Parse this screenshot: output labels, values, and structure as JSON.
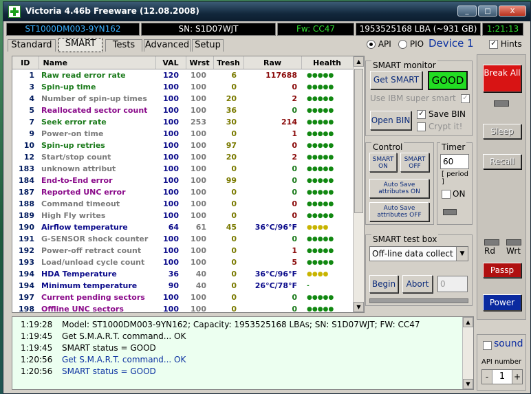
{
  "window": {
    "title": "Victoria 4.46b Freeware (12.08.2008)",
    "controls": [
      "_",
      "□",
      "X"
    ]
  },
  "info": {
    "model": "ST1000DM003-9YN162",
    "serial": "SN: S1D07WJT",
    "firmware": "Fw: CC47",
    "capacity": "1953525168 LBA (~931 GB)",
    "clock": "1:21:13"
  },
  "tabs": [
    {
      "label": "Standard"
    },
    {
      "label": "SMART"
    },
    {
      "label": "Tests"
    },
    {
      "label": "Advanced"
    },
    {
      "label": "Setup"
    }
  ],
  "mode": {
    "api_label": "API",
    "pio_label": "PIO",
    "device": "Device 1",
    "hints_label": "Hints"
  },
  "table": {
    "headers": [
      "ID",
      "Name",
      "VAL",
      "Wrst",
      "Tresh",
      "Raw",
      "Health"
    ],
    "rows": [
      {
        "id": "1",
        "name": "Raw read error rate",
        "val": "120",
        "wrst": "100",
        "tresh": "6",
        "raw": "117688",
        "health": "●●●●●",
        "nc": "#1a7a1a",
        "rc": "#8a0a0a",
        "hc": "#118811"
      },
      {
        "id": "3",
        "name": "Spin-up time",
        "val": "100",
        "wrst": "100",
        "tresh": "0",
        "raw": "0",
        "health": "●●●●●",
        "nc": "#1a7a1a",
        "rc": "#8a0a0a",
        "hc": "#118811"
      },
      {
        "id": "4",
        "name": "Number of spin-up times",
        "val": "100",
        "wrst": "100",
        "tresh": "20",
        "raw": "2",
        "health": "●●●●●",
        "nc": "#7a7a7a",
        "rc": "#8a0a0a",
        "hc": "#118811"
      },
      {
        "id": "5",
        "name": "Reallocated sector count",
        "val": "100",
        "wrst": "100",
        "tresh": "36",
        "raw": "0",
        "health": "●●●●●",
        "nc": "#8a0a8a",
        "rc": "#1a7a1a",
        "hc": "#118811"
      },
      {
        "id": "7",
        "name": "Seek error rate",
        "val": "100",
        "wrst": "253",
        "tresh": "30",
        "raw": "214",
        "health": "●●●●●",
        "nc": "#1a7a1a",
        "rc": "#8a0a0a",
        "hc": "#118811"
      },
      {
        "id": "9",
        "name": "Power-on time",
        "val": "100",
        "wrst": "100",
        "tresh": "0",
        "raw": "1",
        "health": "●●●●●",
        "nc": "#7a7a7a",
        "rc": "#8a0a0a",
        "hc": "#118811"
      },
      {
        "id": "10",
        "name": "Spin-up retries",
        "val": "100",
        "wrst": "100",
        "tresh": "97",
        "raw": "0",
        "health": "●●●●●",
        "nc": "#1a7a1a",
        "rc": "#8a0a0a",
        "hc": "#118811"
      },
      {
        "id": "12",
        "name": "Start/stop count",
        "val": "100",
        "wrst": "100",
        "tresh": "20",
        "raw": "2",
        "health": "●●●●●",
        "nc": "#7a7a7a",
        "rc": "#8a0a0a",
        "hc": "#118811"
      },
      {
        "id": "183",
        "name": "unknown attribut",
        "val": "100",
        "wrst": "100",
        "tresh": "0",
        "raw": "0",
        "health": "●●●●●",
        "nc": "#7a7a7a",
        "rc": "#1a7a1a",
        "hc": "#118811"
      },
      {
        "id": "184",
        "name": "End-to-End error",
        "val": "100",
        "wrst": "100",
        "tresh": "99",
        "raw": "0",
        "health": "●●●●●",
        "nc": "#8a0a8a",
        "rc": "#1a7a1a",
        "hc": "#118811"
      },
      {
        "id": "187",
        "name": "Reported UNC error",
        "val": "100",
        "wrst": "100",
        "tresh": "0",
        "raw": "0",
        "health": "●●●●●",
        "nc": "#8a0a8a",
        "rc": "#1a7a1a",
        "hc": "#118811"
      },
      {
        "id": "188",
        "name": "Command timeout",
        "val": "100",
        "wrst": "100",
        "tresh": "0",
        "raw": "0",
        "health": "●●●●●",
        "nc": "#7a7a7a",
        "rc": "#8a0a0a",
        "hc": "#118811"
      },
      {
        "id": "189",
        "name": "High Fly writes",
        "val": "100",
        "wrst": "100",
        "tresh": "0",
        "raw": "0",
        "health": "●●●●●",
        "nc": "#7a7a7a",
        "rc": "#8a0a0a",
        "hc": "#118811"
      },
      {
        "id": "190",
        "name": "Airflow temperature",
        "val": "64",
        "wrst": "61",
        "tresh": "45",
        "raw": "36°C/96°F",
        "health": "●●●●",
        "nc": "#0a0a8a",
        "rc": "#0a0a8a",
        "hc": "#c8b400"
      },
      {
        "id": "191",
        "name": "G-SENSOR shock counter",
        "val": "100",
        "wrst": "100",
        "tresh": "0",
        "raw": "0",
        "health": "●●●●●",
        "nc": "#7a7a7a",
        "rc": "#1a7a1a",
        "hc": "#118811"
      },
      {
        "id": "192",
        "name": "Power-off retract count",
        "val": "100",
        "wrst": "100",
        "tresh": "0",
        "raw": "1",
        "health": "●●●●●",
        "nc": "#7a7a7a",
        "rc": "#8a0a0a",
        "hc": "#118811"
      },
      {
        "id": "193",
        "name": "Load/unload cycle count",
        "val": "100",
        "wrst": "100",
        "tresh": "0",
        "raw": "5",
        "health": "●●●●●",
        "nc": "#7a7a7a",
        "rc": "#8a0a0a",
        "hc": "#118811"
      },
      {
        "id": "194",
        "name": "HDA Temperature",
        "val": "36",
        "wrst": "40",
        "tresh": "0",
        "raw": "36°C/96°F",
        "health": "●●●●",
        "nc": "#0a0a8a",
        "rc": "#0a0a8a",
        "hc": "#c8b400"
      },
      {
        "id": "194",
        "name": "Minimum temperature",
        "val": "90",
        "wrst": "40",
        "tresh": "0",
        "raw": "26°C/78°F",
        "health": "-",
        "nc": "#0a0a8a",
        "rc": "#0a0a8a",
        "hc": "#118811"
      },
      {
        "id": "197",
        "name": "Current pending sectors",
        "val": "100",
        "wrst": "100",
        "tresh": "0",
        "raw": "0",
        "health": "●●●●●",
        "nc": "#8a0a8a",
        "rc": "#1a7a1a",
        "hc": "#118811"
      },
      {
        "id": "198",
        "name": "Offline UNC sectors",
        "val": "100",
        "wrst": "100",
        "tresh": "0",
        "raw": "0",
        "health": "●●●●●",
        "nc": "#8a0a8a",
        "rc": "#1a7a1a",
        "hc": "#118811"
      }
    ]
  },
  "smart_monitor": {
    "title": "SMART monitor",
    "get_smart": "Get SMART",
    "status": "GOOD",
    "ibm_label": "Use IBM super smart",
    "open_bin": "Open BIN",
    "save_bin": "Save BIN",
    "crypt": "Crypt it!"
  },
  "control": {
    "title": "Control",
    "smart_on": "SMART ON",
    "smart_off": "SMART OFF",
    "autosave_on": "Auto Save attributes ON",
    "autosave_off": "Auto Save attributes OFF"
  },
  "timer": {
    "title": "Timer",
    "value": "60",
    "period": "[ period ]",
    "on_label": "ON"
  },
  "test_box": {
    "title": "SMART test box",
    "selected": "Off-line data collect",
    "begin": "Begin",
    "abort": "Abort",
    "field": "0"
  },
  "right_panel": {
    "break_all": "Break All",
    "sleep": "Sleep",
    "recall": "Recall",
    "rd": "Rd",
    "wrt": "Wrt",
    "passp": "Passp",
    "power": "Power"
  },
  "bottom_right": {
    "sound": "sound",
    "api_number_label": "API number",
    "minus": "-",
    "api_number": "1",
    "plus": "+"
  },
  "log": [
    {
      "time": "1:19:28",
      "text": "Model: ST1000DM003-9YN162; Capacity: 1953525168 LBAs; SN: S1D07WJT; FW: CC47",
      "color": "#000000"
    },
    {
      "time": "1:19:45",
      "text": "Get S.M.A.R.T. command... OK",
      "color": "#000000"
    },
    {
      "time": "1:19:45",
      "text": "SMART status = GOOD",
      "color": "#000000"
    },
    {
      "time": "1:20:56",
      "text": "Get S.M.A.R.T. command... OK",
      "color": "#0a30a0"
    },
    {
      "time": "1:20:56",
      "text": "SMART status = GOOD",
      "color": "#0a30a0"
    }
  ],
  "colors": {
    "good": "#22dd22",
    "break_all": "#cc1111",
    "passp": "#b01010",
    "power": "#0a2aa0"
  }
}
